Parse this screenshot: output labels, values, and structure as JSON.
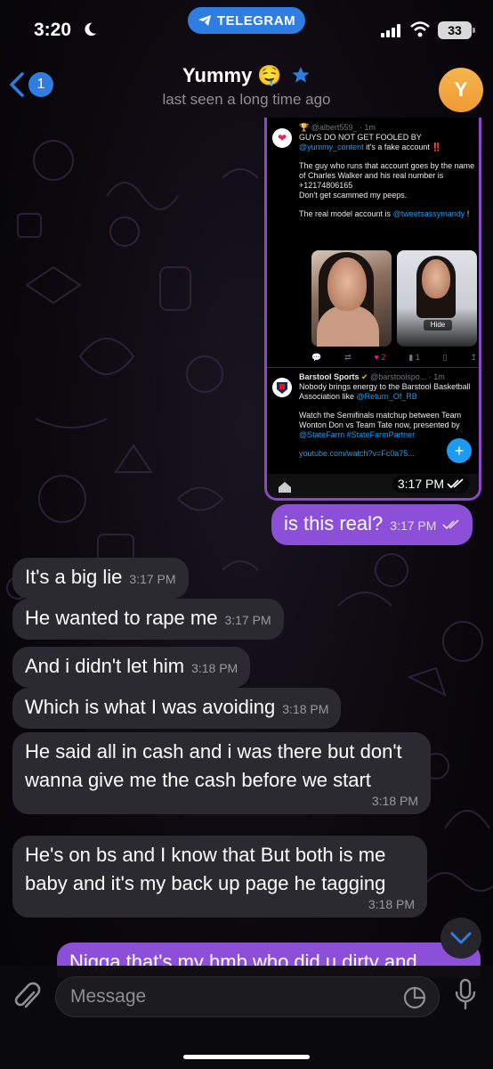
{
  "status_bar": {
    "time": "3:20",
    "pill_label": "TELEGRAM",
    "battery": "33"
  },
  "header": {
    "back_count": "1",
    "title": "Yummy 🤤",
    "subtitle": "last seen a long time ago",
    "avatar_initial": "Y"
  },
  "screenshot": {
    "tweet1": {
      "handle": "🏆 @albert559_ · 1m",
      "line1": "GUYS DO NOT GET FOOLED BY",
      "mention": "@yummy_content",
      "line1b": " it's a fake account ‼️",
      "line2": "The guy who runs that account goes by the name of Charles Walker and his real number is +12174806165",
      "line3": "Don't get scammed my peeps.",
      "line4": "The real model account is",
      "real_account": "@tweetsassymandy",
      "line4b": " !",
      "hide_label": "Hide",
      "likes": "2",
      "views": "1"
    },
    "tweet2": {
      "name": "Barstool Sports",
      "handle": "@barstoolspo... · 1m",
      "text1": "Nobody brings energy to the Barstool Basketball Association like",
      "mention1": "@Return_Of_RB",
      "text2": "Watch the Semifinals matchup between Team Wonton Don vs Team Tate now, presented by",
      "mention2": "@StateFarm #StateFarmPartner",
      "link": "youtube.com/watch?v=Fc0a75..."
    },
    "time": "3:17 PM"
  },
  "messages": [
    {
      "dir": "out",
      "text": "is this real?",
      "time": "3:17 PM"
    },
    {
      "dir": "in",
      "text": "It's a big lie",
      "time": "3:17 PM"
    },
    {
      "dir": "in",
      "text": "He wanted to rape me",
      "time": "3:17 PM"
    },
    {
      "dir": "in",
      "text": "And i didn't let him",
      "time": "3:18 PM"
    },
    {
      "dir": "in",
      "text": "Which is what I was avoiding",
      "time": "3:18 PM"
    },
    {
      "dir": "in",
      "text": "He said all in cash and i was there but don't wanna give me the cash before we start",
      "time": "3:18 PM"
    },
    {
      "dir": "in",
      "text": "He's on bs and I know that But both is me baby and it's my back up page he tagging",
      "time": "3:18 PM"
    },
    {
      "dir": "out",
      "text": "Nigga that's my hmb who did u dirty and",
      "time": ""
    }
  ],
  "input": {
    "placeholder": "Message"
  },
  "colors": {
    "accent": "#2f7de0",
    "outgoing_bubble": "#8c4fd8",
    "incoming_bubble": "#2b2a31",
    "avatar": "#f2a23f"
  }
}
